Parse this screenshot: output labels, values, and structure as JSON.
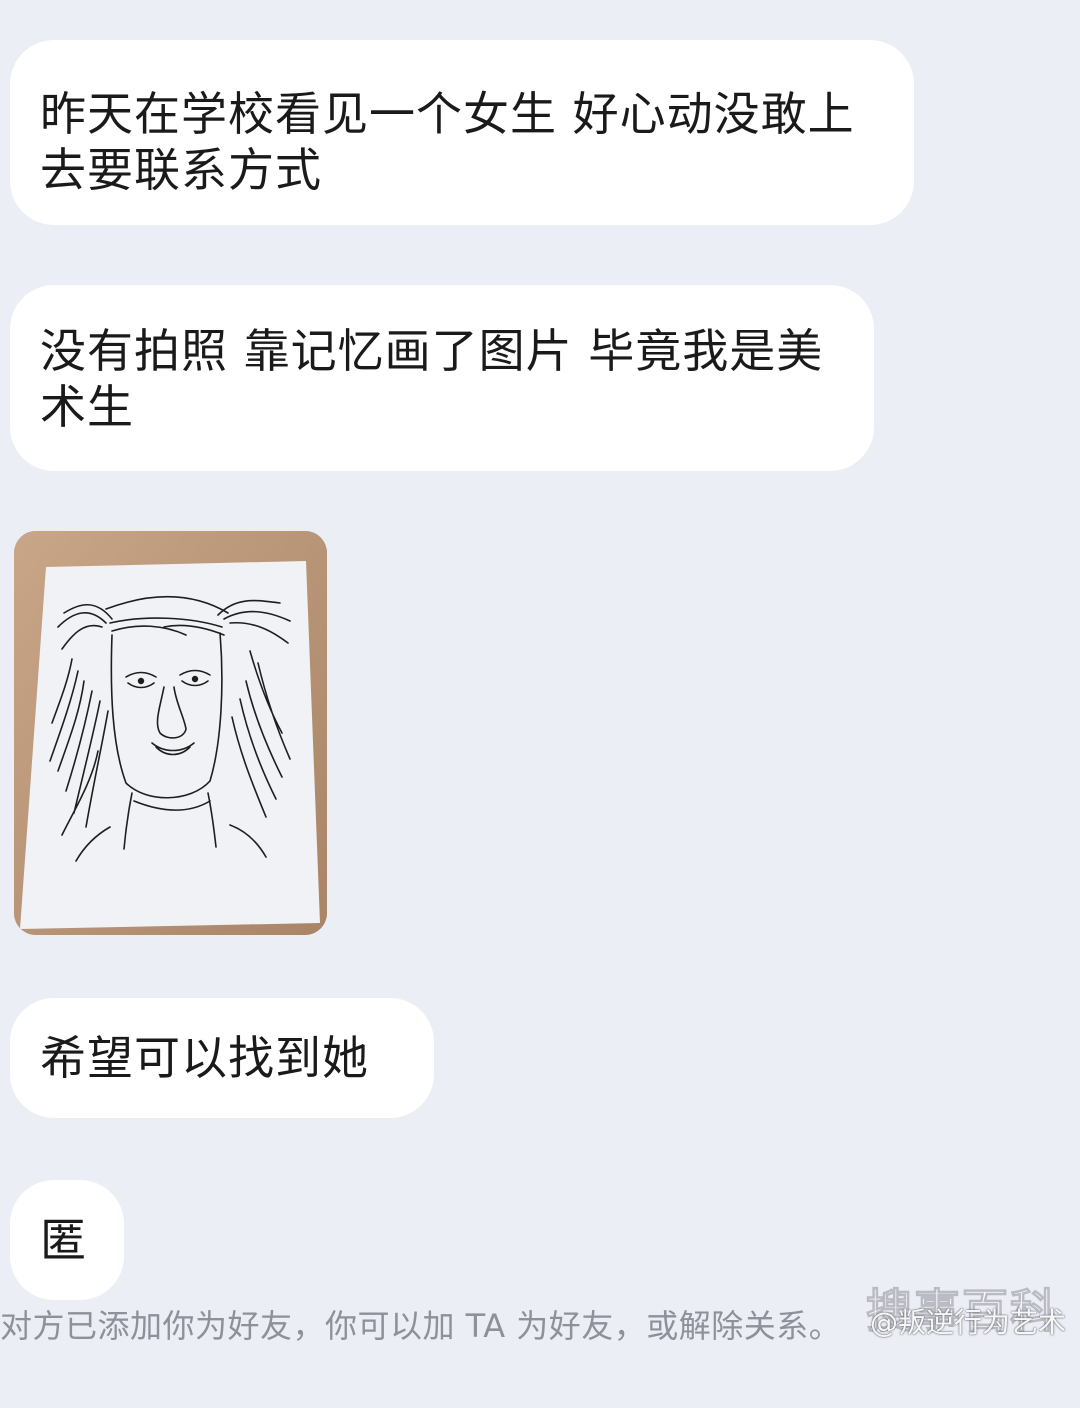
{
  "messages": [
    {
      "text": "昨天在学校看见一个女生 好心动没敢上去要联系方式"
    },
    {
      "text": "没有拍照 靠记忆画了图片 毕竟我是美术生"
    },
    {
      "text": "希望可以找到她"
    },
    {
      "text": "匿"
    }
  ],
  "image_message": {
    "icon": "sketch-portrait-photo"
  },
  "system_notice": "对方已添加你为好友，你可以加 TA 为好友，或解除关系。",
  "watermark": {
    "logo_text": "搜事百科",
    "credit": "@叛逆行为艺术"
  },
  "colors": {
    "background": "#eceef6",
    "bubble": "#ffffff",
    "notice_text": "#8e909a"
  }
}
